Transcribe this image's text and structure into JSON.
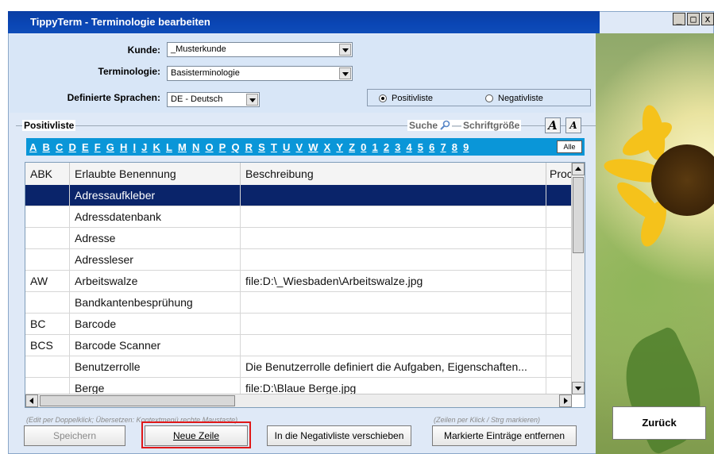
{
  "window": {
    "title": "TippyTerm - Terminologie bearbeiten"
  },
  "window_buttons": {
    "minimize": "_",
    "maximize": "□",
    "close": "x"
  },
  "form": {
    "kunde_label": "Kunde:",
    "kunde_value": "_Musterkunde",
    "terminologie_label": "Terminologie:",
    "terminologie_value": "Basisterminologie",
    "sprachen_label": "Definierte Sprachen:",
    "sprachen_value": "DE - Deutsch",
    "radio_positiv": "Positivliste",
    "radio_negativ": "Negativliste",
    "selected_list": "Positivliste"
  },
  "list_group": {
    "label": "Positivliste",
    "search_label": "Suche",
    "font_size_label": "Schriftgröße",
    "font_larger": "A",
    "font_smaller": "A"
  },
  "alphabet": [
    "A",
    "B",
    "C",
    "D",
    "E",
    "F",
    "G",
    "H",
    "I",
    "J",
    "K",
    "L",
    "M",
    "N",
    "O",
    "P",
    "Q",
    "R",
    "S",
    "T",
    "U",
    "V",
    "W",
    "X",
    "Y",
    "Z",
    "0",
    "1",
    "2",
    "3",
    "4",
    "5",
    "6",
    "7",
    "8",
    "9"
  ],
  "alle_button": "Alle",
  "table": {
    "columns": [
      "ABK",
      "Erlaubte Benennung",
      "Beschreibung",
      "Proc"
    ],
    "rows": [
      {
        "abk": "",
        "benennung": "Adressaufkleber",
        "beschreibung": "",
        "selected": true
      },
      {
        "abk": "",
        "benennung": "Adressdatenbank",
        "beschreibung": ""
      },
      {
        "abk": "",
        "benennung": "Adresse",
        "beschreibung": ""
      },
      {
        "abk": "",
        "benennung": "Adressleser",
        "beschreibung": ""
      },
      {
        "abk": "AW",
        "benennung": "Arbeitswalze",
        "beschreibung": "file:D:\\_Wiesbaden\\Arbeitswalze.jpg"
      },
      {
        "abk": "",
        "benennung": "Bandkantenbesprühung",
        "beschreibung": ""
      },
      {
        "abk": "BC",
        "benennung": "Barcode",
        "beschreibung": ""
      },
      {
        "abk": "BCS",
        "benennung": "Barcode Scanner",
        "beschreibung": ""
      },
      {
        "abk": "",
        "benennung": "Benutzerrolle",
        "beschreibung": "Die Benutzerrolle definiert die Aufgaben, Eigenschaften..."
      },
      {
        "abk": "",
        "benennung": "Berge",
        "beschreibung": "file:D:\\Blaue Berge.jpg"
      }
    ]
  },
  "hints": {
    "left": "(Edit per Doppelklick; Übersetzen: Kontextmenü rechte Maustaste)",
    "right": "(Zeilen per Klick / Strg markieren)"
  },
  "buttons": {
    "speichern": "Speichern",
    "neue_zeile": "Neue Zeile",
    "negativliste": "In die Negativliste verschieben",
    "entfernen": "Markierte Einträge entfernen",
    "zurueck": "Zurück"
  },
  "colors": {
    "title_bar": "#0a46b5",
    "alphabet_bar": "#0a96d8",
    "selection": "#0a246a",
    "highlight_border": "#e01818"
  }
}
